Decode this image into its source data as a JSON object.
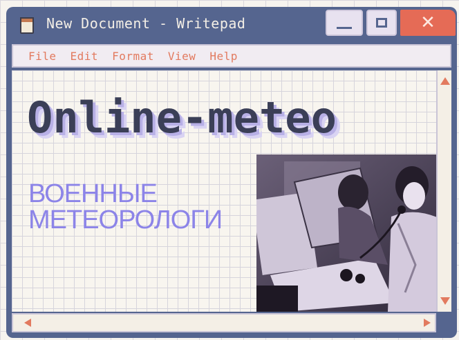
{
  "window": {
    "title": "New Document - Writepad",
    "app_icon": "notepad-icon",
    "controls": {
      "minimize_icon": "minimize-icon",
      "maximize_icon": "maximize-icon",
      "close_icon": "close-icon",
      "close_glyph": "✕"
    }
  },
  "menu": {
    "items": [
      "File",
      "Edit",
      "Format",
      "View",
      "Help"
    ]
  },
  "document": {
    "logo_text": "Online-meteo",
    "subtitle_line1": "ВОЕННЫЕ",
    "subtitle_line2": "МЕТЕОРОЛОГИ",
    "photo_description_icon": "photo-image"
  },
  "colors": {
    "window_frame": "#55658f",
    "accent_orange": "#e27a5f",
    "close_red": "#e56b56",
    "logo_dark": "#3b3f57",
    "logo_shadow": "#b8b0e6",
    "subtitle_purple": "#8c84e8"
  }
}
